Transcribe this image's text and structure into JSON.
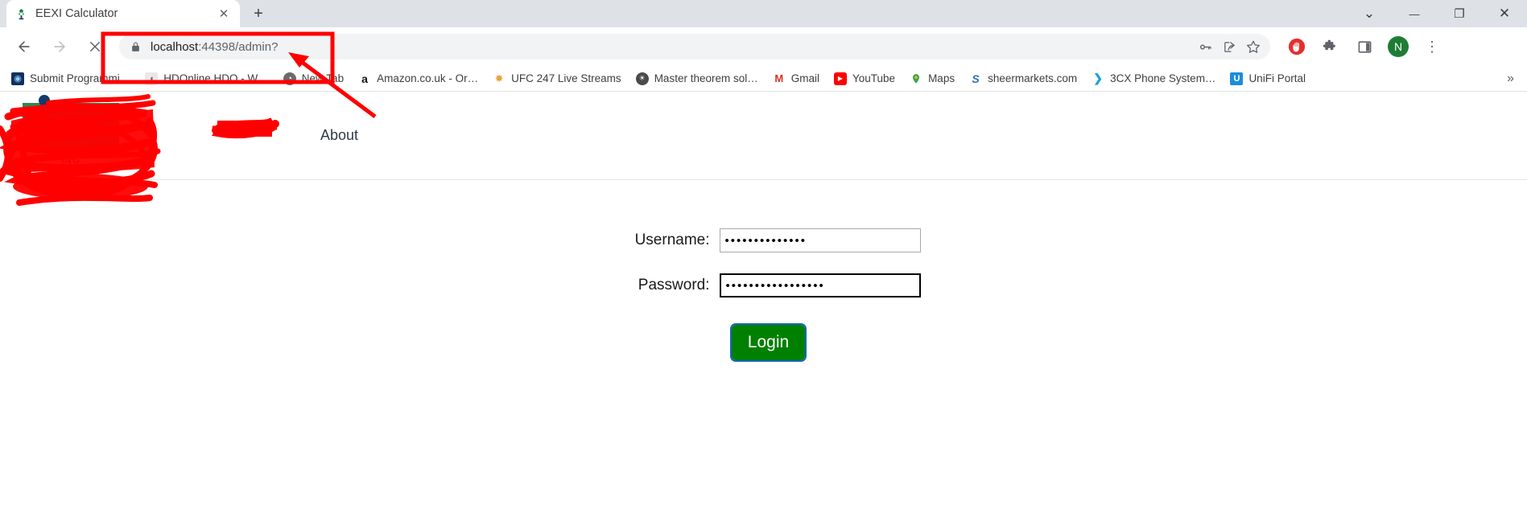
{
  "window": {
    "controls": [
      {
        "name": "tab-search",
        "glyph": "⌄"
      },
      {
        "name": "minimize",
        "glyph": "—"
      },
      {
        "name": "maximize",
        "glyph": "❐"
      },
      {
        "name": "close",
        "glyph": "✕"
      }
    ]
  },
  "tabs": [
    {
      "title": "EEXI Calculator",
      "favicon": "eexi-calculator-favicon",
      "close_glyph": "✕"
    }
  ],
  "new_tab_glyph": "+",
  "toolbar": {
    "back_glyph": "←",
    "forward_glyph": "→",
    "stop_glyph": "✕",
    "lock_icon": "lock-icon",
    "url": "localhost:44398/admin?",
    "url_host": "localhost",
    "url_path": ":44398/admin?",
    "omni_icons": [
      {
        "name": "password-key-icon",
        "glyph": "⚿"
      },
      {
        "name": "share-icon",
        "glyph": "➦"
      },
      {
        "name": "bookmark-star-icon",
        "glyph": "☆"
      }
    ],
    "extensions": [
      {
        "name": "adblock-icon",
        "label": "",
        "color": "#e02020"
      },
      {
        "name": "extensions-puzzle-icon",
        "glyph": "❖",
        "color": "#5f6368"
      },
      {
        "name": "side-panel-icon",
        "glyph": "▣",
        "color": "#5f6368"
      }
    ],
    "avatar_letter": "N",
    "menu_glyph": "⋮"
  },
  "bookmarks": {
    "items": [
      {
        "label": "Submit Programmi…",
        "icon": "globe-blue-icon",
        "color": "#1b3a6b",
        "glyph": "◉"
      },
      {
        "label": "HDOnline HDO - W…",
        "icon": "hdonline-icon",
        "color": "#7a7a7a",
        "glyph": "◖"
      },
      {
        "label": "New Tab",
        "icon": "chrome-icon",
        "color": "#555555",
        "glyph": "◔"
      },
      {
        "label": "Amazon.co.uk - Or…",
        "icon": "amazon-icon",
        "color": "#111111",
        "glyph": "a"
      },
      {
        "label": "UFC 247 Live Streams",
        "icon": "star-burst-icon",
        "color": "#e8a33d",
        "glyph": "✸"
      },
      {
        "label": "Master theorem sol…",
        "icon": "globe-dark-icon",
        "color": "#4a4a4a",
        "glyph": "●"
      },
      {
        "label": "Gmail",
        "icon": "gmail-icon",
        "color": "#d93025",
        "glyph": "M"
      },
      {
        "label": "YouTube",
        "icon": "youtube-icon",
        "color": "#ff0000",
        "glyph": "▶"
      },
      {
        "label": "Maps",
        "icon": "google-maps-icon",
        "color": "#34a853",
        "glyph": "◉"
      },
      {
        "label": "sheermarkets.com",
        "icon": "sheermarkets-icon",
        "color": "#2d6fb8",
        "glyph": "S"
      },
      {
        "label": "3CX Phone System…",
        "icon": "3cx-icon",
        "color": "#1a9fe0",
        "glyph": "❯"
      },
      {
        "label": "UniFi Portal",
        "icon": "unifi-icon",
        "color": "#1b8ddb",
        "glyph": "U"
      }
    ],
    "overflow_glyph": "»"
  },
  "site": {
    "logo": {
      "name": "company-logo-redacted",
      "wordmark": "ING"
    },
    "nav": [
      {
        "label": "",
        "name": "nav-item-redacted",
        "redacted": true
      },
      {
        "label": "About",
        "name": "nav-item-about",
        "redacted": false
      }
    ]
  },
  "login": {
    "username": {
      "label": "Username:",
      "value": "••••••••••••••",
      "placeholder": "",
      "focused": false
    },
    "password": {
      "label": "Password:",
      "value": "•••••••••••••••••",
      "placeholder": "",
      "focused": true
    },
    "submit_label": "Login",
    "submit_color": "#008000"
  },
  "annotations": {
    "highlight_color": "#ff0000",
    "url_box": true,
    "arrow_to_url": true
  }
}
